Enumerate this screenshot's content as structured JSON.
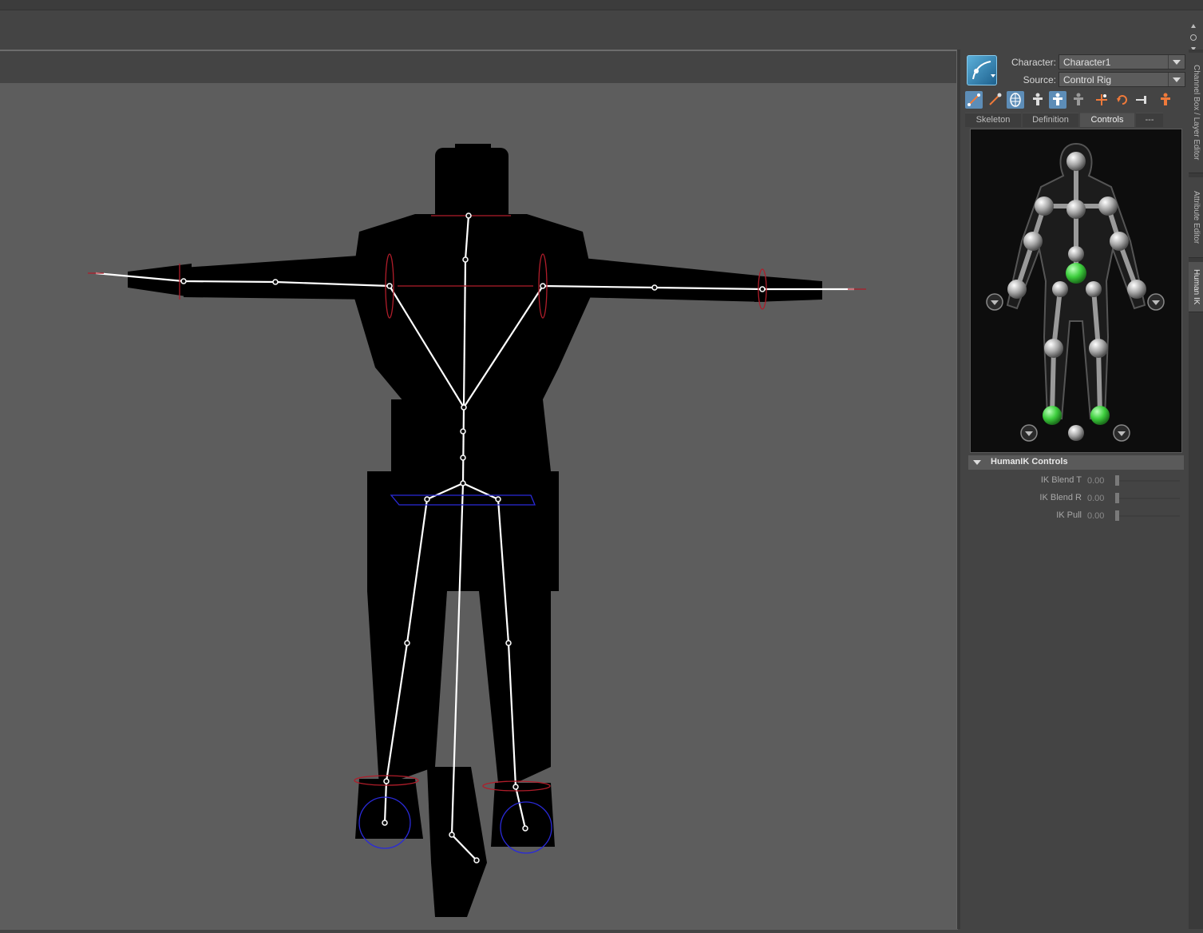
{
  "humanik": {
    "character_label": "Character:",
    "character_value": "Character1",
    "source_label": "Source:",
    "source_value": "Control Rig",
    "tabs": [
      "Skeleton",
      "Definition",
      "Controls",
      "---"
    ],
    "active_tab": "Controls",
    "controls_section_title": "HumanIK Controls",
    "sliders": [
      {
        "label": "IK Blend T",
        "value": "0.00"
      },
      {
        "label": "IK Blend R",
        "value": "0.00"
      },
      {
        "label": "IK Pull",
        "value": "0.00"
      }
    ],
    "toolbar_icons": [
      "edit-joint-icon",
      "pin-icon",
      "full-body-icon",
      "character-icon",
      "body-part-icon",
      "selection-icon",
      "add-pivot-icon",
      "reset-icon",
      "mirror-icon",
      "character-orange-icon"
    ]
  },
  "side_tabs": [
    "Channel Box / Layer Editor",
    "Attribute Editor",
    "Human IK"
  ],
  "active_side_tab": "Human IK",
  "colors": {
    "panel_bg": "#444444",
    "viewport_bg": "#5d5d5d",
    "active_tab": "#5d8db7",
    "effector_green": "#3ecf3e"
  }
}
